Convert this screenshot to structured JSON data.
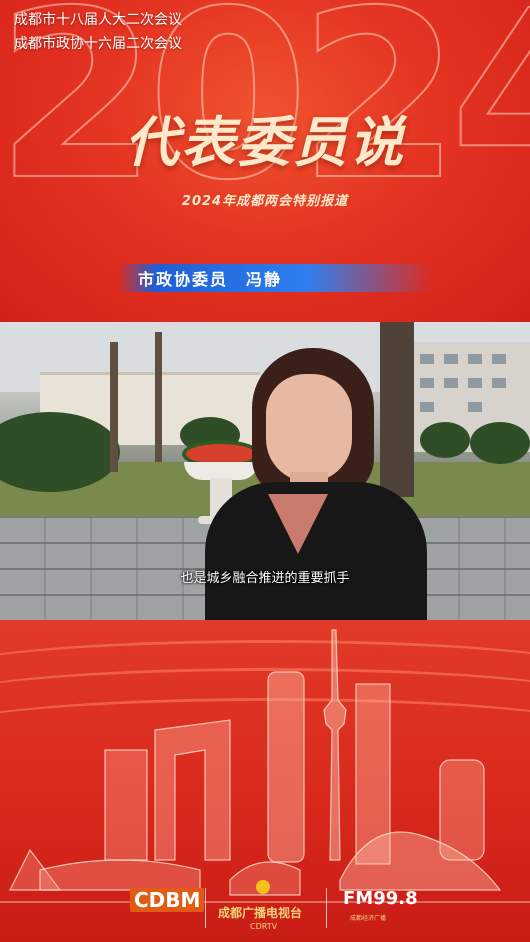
{
  "header": {
    "meeting_line_1": "成都市十八届人大二次会议",
    "meeting_line_2": "成都市政协十六届二次会议",
    "year_watermark": "2024",
    "title": "代表委员说",
    "subtitle": "2024年成都两会特别报道"
  },
  "video": {
    "caption": "也是城乡融合推进的重要抓手",
    "name_bar": "市政协委员　冯静"
  },
  "footer": {
    "logo_cdbm": "CDBM",
    "logo_cdtv": "成都广播电视台",
    "logo_cdtv_sub": "CDRTV",
    "logo_fm": "FM99.8",
    "logo_fm_sub": "成都经济广播"
  },
  "colors": {
    "primary_red": "#e12a1e",
    "title_cream": "#fde9c9",
    "name_bar_blue": "#2f7ff0"
  }
}
